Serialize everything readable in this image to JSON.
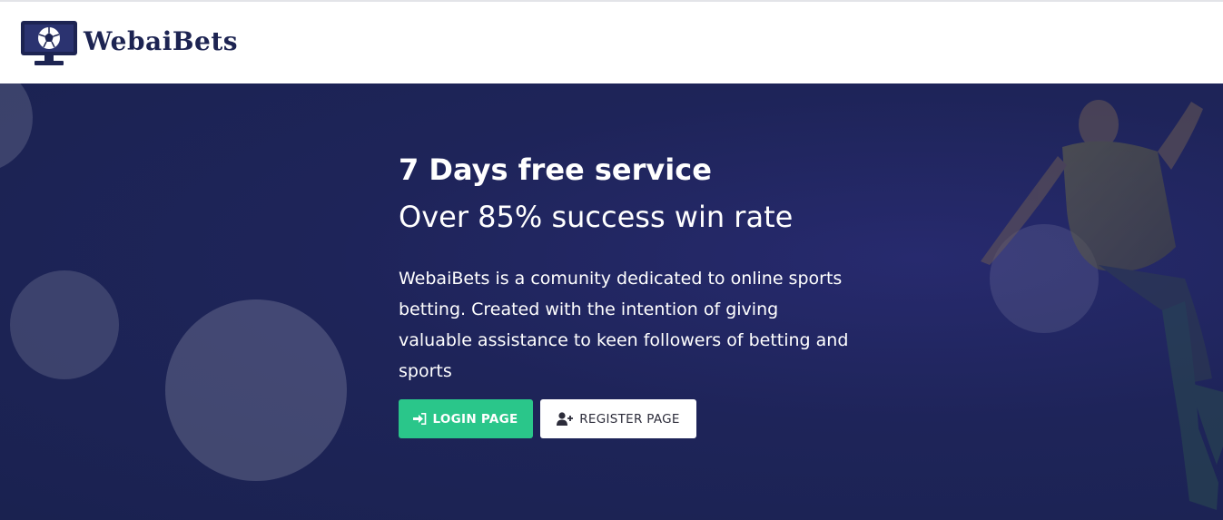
{
  "brand": {
    "name": "WebaiBets",
    "logo_icon": "monitor-soccer-ball-icon",
    "colors": {
      "brand": "#1d2452",
      "accent": "#2ac68a",
      "hero_bg": "#1e2459"
    }
  },
  "hero": {
    "headline": "7 Days free service",
    "subheadline": "Over 85% success win rate",
    "description": "WebaiBets is a comunity dedicated to online sports betting. Created with the intention of giving valuable assistance to keen followers of betting and sports",
    "login_button": {
      "label": "LOGIN PAGE",
      "icon": "sign-in-icon"
    },
    "register_button": {
      "label": "REGISTER PAGE",
      "icon": "user-plus-icon"
    }
  }
}
